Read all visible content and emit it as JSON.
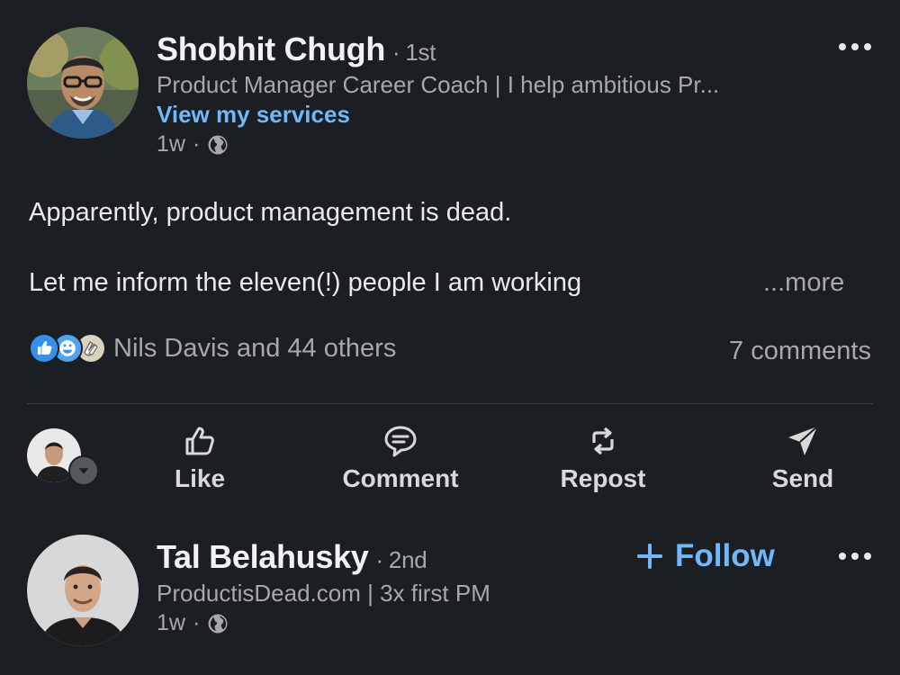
{
  "post": {
    "author": {
      "name": "Shobhit Chugh",
      "degree": "1st",
      "headline": "Product Manager Career Coach | I help ambitious Pr...",
      "services_link": "View my services",
      "time": "1w"
    },
    "text": {
      "line1": "Apparently, product management is dead.",
      "line2": "Let me inform the eleven(!) people I am working",
      "see_more": "...more"
    },
    "social": {
      "reactions_text": "Nils Davis and 44 others",
      "comments_text": "7 comments",
      "reaction_icons": [
        "like-icon",
        "celebrate-icon",
        "clap-icon"
      ]
    },
    "actions": {
      "like": "Like",
      "comment": "Comment",
      "repost": "Repost",
      "send": "Send"
    }
  },
  "next_post": {
    "author": {
      "name": "Tal Belahusky",
      "degree": "2nd",
      "headline": "ProductisDead.com | 3x first PM",
      "time": "1w"
    },
    "follow_label": "Follow"
  },
  "colors": {
    "background": "#1b1f23",
    "link": "#71b7fb",
    "secondary_text": "#a6a8aa",
    "primary_text": "#e9e9e9"
  }
}
